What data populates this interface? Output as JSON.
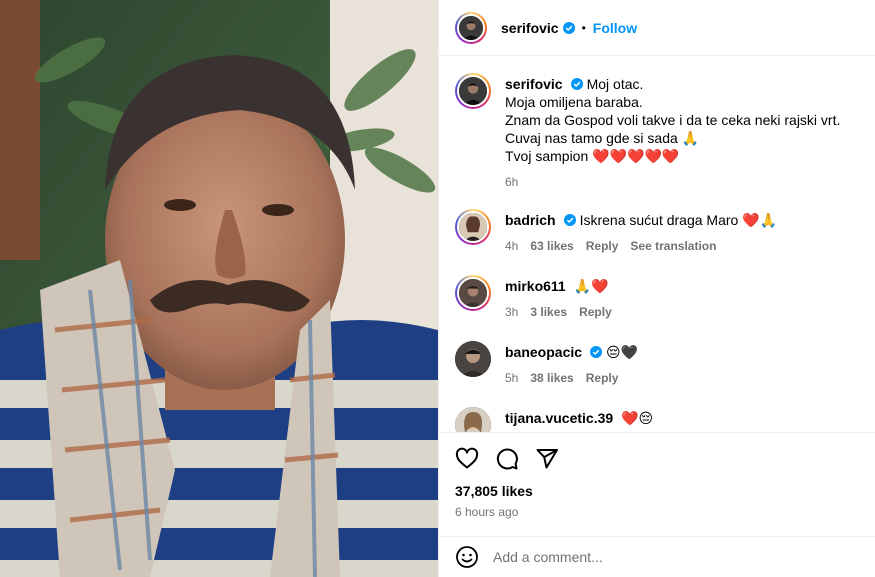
{
  "post": {
    "author": "serifovic",
    "follow_label": "Follow",
    "separator": "•",
    "caption_lines": [
      "Moj otac.",
      "Moja omiljena baraba.",
      "Znam da Gospod voli takve i da te ceka neki rajski vrt.",
      "Cuvaj nas tamo gde si sada 🙏",
      "Tvoj sampion ❤️❤️❤️❤️❤️"
    ],
    "caption_time": "6h"
  },
  "comments": [
    {
      "user": "badrich",
      "verified": true,
      "text": "Iskrena sućut draga Maro ❤️🙏",
      "time": "4h",
      "likes": "63 likes",
      "reply": "Reply",
      "translate": "See translation"
    },
    {
      "user": "mirko611",
      "verified": false,
      "text": "🙏❤️",
      "time": "3h",
      "likes": "3 likes",
      "reply": "Reply"
    },
    {
      "user": "baneopacic",
      "verified": true,
      "text": "😔🖤",
      "time": "5h",
      "likes": "38 likes",
      "reply": "Reply"
    },
    {
      "user": "tijana.vucetic.39",
      "verified": false,
      "text": "❤️😔",
      "time": "",
      "likes": "",
      "reply": ""
    }
  ],
  "actions": {
    "like_icon": "heart-outline-icon",
    "comment_icon": "comment-bubble-icon",
    "share_icon": "paper-plane-icon"
  },
  "likes_count": "37,805 likes",
  "posted_ago": "6 hours ago",
  "add_comment": {
    "placeholder": "Add a comment...",
    "emoji_icon": "smiley-icon"
  },
  "colors": {
    "accent": "#0095f6",
    "verified": "#0095f6",
    "muted": "#737373",
    "divider": "#efefef"
  }
}
